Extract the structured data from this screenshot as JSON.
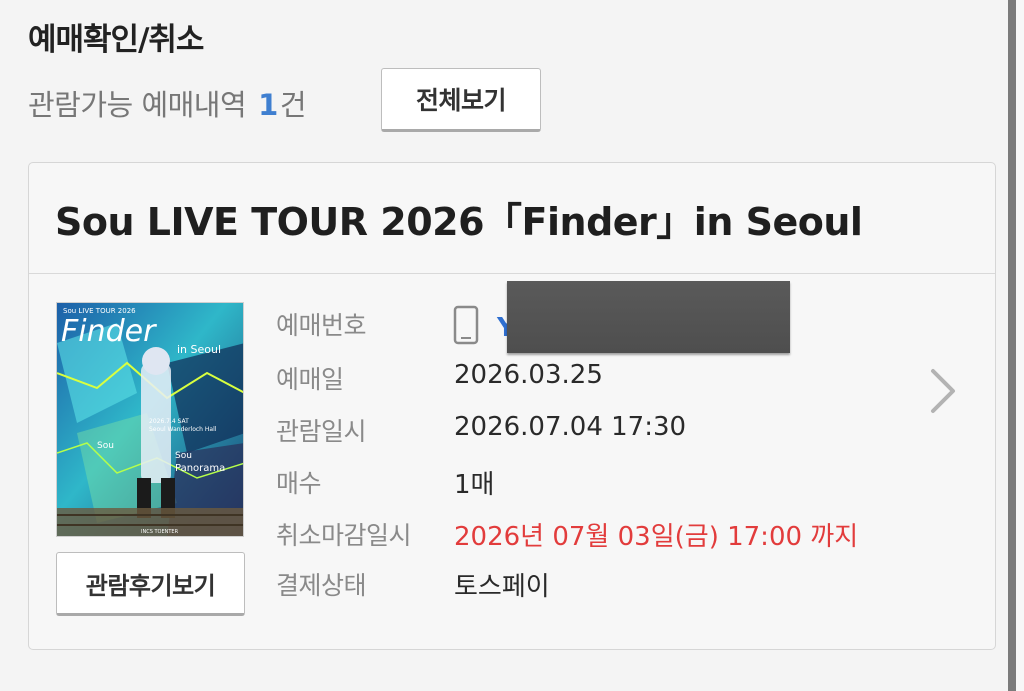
{
  "page": {
    "title": "예매확인/취소",
    "summary_label": "관람가능 예매내역",
    "summary_count": "1",
    "summary_unit": "건",
    "view_all_label": "전체보기"
  },
  "reservation": {
    "title": "Sou LIVE TOUR 2026「Finder」in Seoul",
    "poster": {
      "top_text": "Sou LIVE TOUR 2026",
      "logo": "Finder",
      "logo_sub": "in Seoul",
      "date_text": "2026.7.4 SAT",
      "venue_text": "Seoul Wanderloch Hall",
      "guest_left": "Sou",
      "guest_right_1": "Sou",
      "guest_right_2": "Panorama",
      "footer_text": "INCS TOENTER"
    },
    "review_button_label": "관람후기보기",
    "rows": [
      {
        "label": "예매번호",
        "value": ""
      },
      {
        "label": "예매일",
        "value": "2026.03.25"
      },
      {
        "label": "관람일시",
        "value": "2026.07.04 17:30"
      },
      {
        "label": "매수",
        "value": "1매"
      },
      {
        "label": "취소마감일시",
        "value": "2026년 07월 03일(금) 17:00 까지"
      },
      {
        "label": "결제상태",
        "value": "토스페이"
      }
    ],
    "ticket_number_visible": "Y",
    "highlight_color": "#e23c3c",
    "accent_color": "#3f7fd0"
  }
}
